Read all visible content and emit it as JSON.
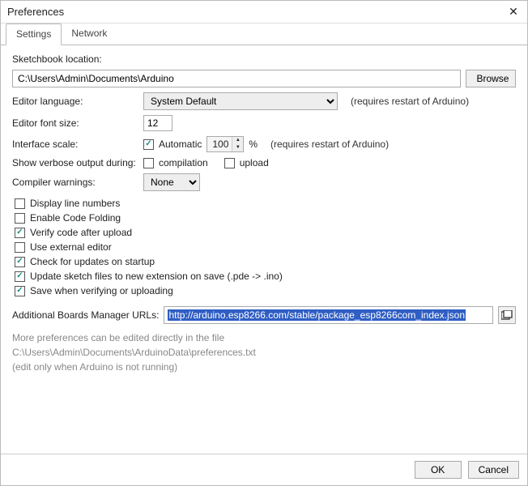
{
  "title": "Preferences",
  "tabs": {
    "settings": "Settings",
    "network": "Network"
  },
  "sketchbook": {
    "label": "Sketchbook location:",
    "value": "C:\\Users\\Admin\\Documents\\Arduino",
    "browse": "Browse"
  },
  "editor_language": {
    "label": "Editor language:",
    "value": "System Default",
    "note": "(requires restart of Arduino)"
  },
  "font_size": {
    "label": "Editor font size:",
    "value": "12"
  },
  "scale": {
    "label": "Interface scale:",
    "automatic": "Automatic",
    "automatic_checked": true,
    "value": "100",
    "percent": "%",
    "note": "(requires restart of Arduino)"
  },
  "verbose": {
    "label": "Show verbose output during:",
    "compilation": "compilation",
    "compilation_checked": false,
    "upload": "upload",
    "upload_checked": false
  },
  "warnings": {
    "label": "Compiler warnings:",
    "value": "None"
  },
  "options": [
    {
      "label": "Display line numbers",
      "checked": false
    },
    {
      "label": "Enable Code Folding",
      "checked": false
    },
    {
      "label": "Verify code after upload",
      "checked": true
    },
    {
      "label": "Use external editor",
      "checked": false
    },
    {
      "label": "Check for updates on startup",
      "checked": true
    },
    {
      "label": "Update sketch files to new extension on save (.pde -> .ino)",
      "checked": true
    },
    {
      "label": "Save when verifying or uploading",
      "checked": true
    }
  ],
  "boards_url": {
    "label": "Additional Boards Manager URLs:",
    "value": "http://arduino.esp8266.com/stable/package_esp8266com_index.json"
  },
  "footnote": {
    "line1": "More preferences can be edited directly in the file",
    "line2": "C:\\Users\\Admin\\Documents\\ArduinoData\\preferences.txt",
    "line3": "(edit only when Arduino is not running)"
  },
  "buttons": {
    "ok": "OK",
    "cancel": "Cancel"
  }
}
